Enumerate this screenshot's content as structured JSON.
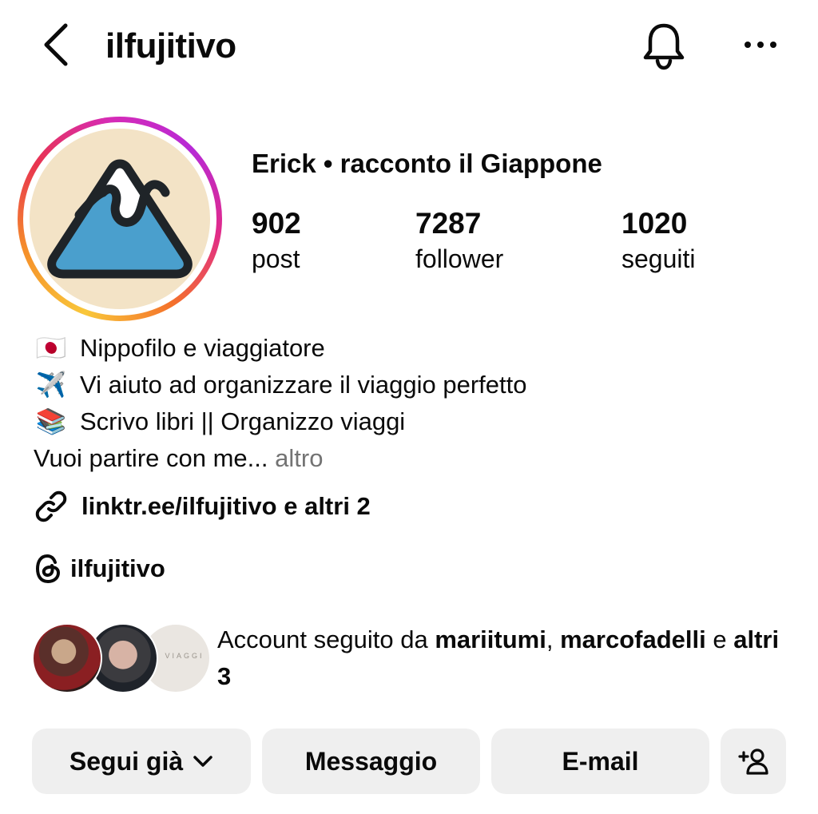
{
  "header": {
    "username": "ilfujitivo",
    "back_icon": "chevron-left-icon",
    "bell_icon": "bell-icon",
    "more_icon": "more-horizontal-icon"
  },
  "profile": {
    "display_name": "Erick • racconto il Giappone",
    "stats": [
      {
        "value": "902",
        "label": "post"
      },
      {
        "value": "7287",
        "label": "follower"
      },
      {
        "value": "1020",
        "label": "seguiti"
      }
    ]
  },
  "bio": {
    "lines": [
      {
        "emoji": "🇯🇵",
        "text": "Nippofilo e viaggiatore"
      },
      {
        "emoji": "✈️",
        "text": "Vi aiuto ad organizzare il viaggio perfetto"
      },
      {
        "emoji": "📚",
        "text": "Scrivo libri || Organizzo viaggi"
      }
    ],
    "last_line": "Vuoi partire con me...",
    "more_label": "altro"
  },
  "link": {
    "text": "linktr.ee/ilfujitivo e altri 2",
    "icon": "link-icon"
  },
  "threads": {
    "handle": "ilfujitivo",
    "icon": "threads-icon"
  },
  "followed_by": {
    "prefix": "Account seguito da",
    "user1": "mariitumi",
    "sep": ",",
    "user2": "marcofadelli",
    "conj": "e",
    "others": "altri 3",
    "avatar3_text": "B VIAGGI"
  },
  "buttons": {
    "follow": "Segui già",
    "message": "Messaggio",
    "email": "E-mail",
    "add_user_icon": "add-user-icon"
  },
  "colors": {
    "button_bg": "#efefef",
    "secondary_text": "#737373",
    "avatar_bg": "#f3e3c6",
    "logo_blue": "#4a9fcd"
  }
}
